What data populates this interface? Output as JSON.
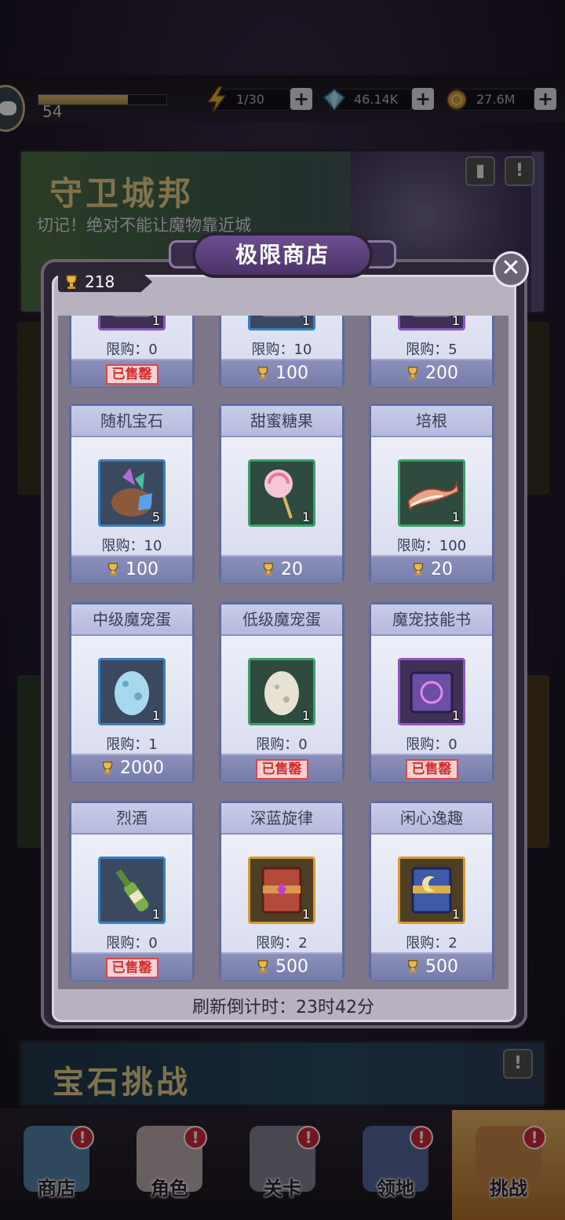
{
  "hud": {
    "level": "54",
    "energy": "1/30",
    "gems": "46.14K",
    "gold": "27.6M"
  },
  "banners": {
    "defend_title": "守卫城邦",
    "defend_subtitle": "切记！绝对不能让魔物靠近城",
    "gem_title": "宝石挑战"
  },
  "shop": {
    "title": "极限商店",
    "currency_amount": "218",
    "refresh_label": "刷新倒计时：23时42分",
    "items": [
      {
        "name": "",
        "limit": "限购：0",
        "price": "",
        "status": "已售罄",
        "count": "1",
        "icon": "item-icon",
        "frame": "purple"
      },
      {
        "name": "",
        "limit": "限购：10",
        "price": "100",
        "status": "",
        "count": "1",
        "icon": "item-icon",
        "frame": "blue"
      },
      {
        "name": "",
        "limit": "限购：5",
        "price": "200",
        "status": "",
        "count": "1",
        "icon": "item-icon",
        "frame": "purple"
      },
      {
        "name": "随机宝石",
        "limit": "限购：10",
        "price": "100",
        "status": "",
        "count": "5",
        "icon": "gem-bag-icon",
        "frame": "blue"
      },
      {
        "name": "甜蜜糖果",
        "limit": "",
        "price": "20",
        "status": "",
        "count": "1",
        "icon": "lollipop-icon",
        "frame": "green"
      },
      {
        "name": "培根",
        "limit": "限购：100",
        "price": "20",
        "status": "",
        "count": "1",
        "icon": "bacon-icon",
        "frame": "green"
      },
      {
        "name": "中级魔宠蛋",
        "limit": "限购：1",
        "price": "2000",
        "status": "",
        "count": "1",
        "icon": "blue-egg-icon",
        "frame": "blue"
      },
      {
        "name": "低级魔宠蛋",
        "limit": "限购：0",
        "price": "",
        "status": "已售罄",
        "count": "1",
        "icon": "white-egg-icon",
        "frame": "green"
      },
      {
        "name": "魔宠技能书",
        "limit": "限购：0",
        "price": "",
        "status": "已售罄",
        "count": "1",
        "icon": "skill-book-icon",
        "frame": "purple"
      },
      {
        "name": "烈酒",
        "limit": "限购：0",
        "price": "",
        "status": "已售罄",
        "count": "1",
        "icon": "wine-bottle-icon",
        "frame": "blue"
      },
      {
        "name": "深蓝旋律",
        "limit": "限购：2",
        "price": "500",
        "status": "",
        "count": "1",
        "icon": "red-book-icon",
        "frame": "gold"
      },
      {
        "name": "闲心逸趣",
        "limit": "限购：2",
        "price": "500",
        "status": "",
        "count": "1",
        "icon": "blue-book-icon",
        "frame": "gold"
      }
    ]
  },
  "nav": [
    {
      "label": "商店",
      "badge": "!"
    },
    {
      "label": "角色",
      "badge": "!"
    },
    {
      "label": "关卡",
      "badge": "!"
    },
    {
      "label": "领地",
      "badge": "!"
    },
    {
      "label": "挑战",
      "badge": "!"
    }
  ]
}
